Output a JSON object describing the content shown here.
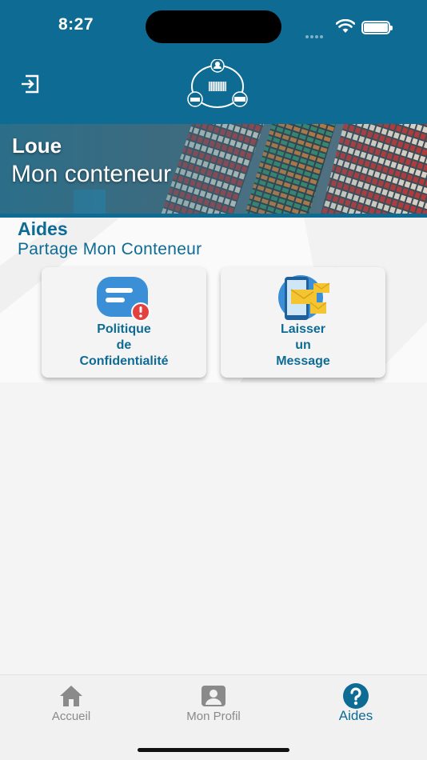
{
  "status_bar": {
    "time": "8:27"
  },
  "header": {
    "logout_icon": "logout-icon",
    "logo_icon": "network-logo-icon"
  },
  "banner": {
    "line1": "Loue",
    "line2": "Mon conteneur"
  },
  "main": {
    "title": "Aides",
    "subtitle": "Partage Mon Conteneur",
    "cards": [
      {
        "label_lines": [
          "Politique",
          "de",
          "Confidentialité"
        ],
        "icon": "privacy-alert-icon"
      },
      {
        "label_lines": [
          "Laisser",
          "un",
          "Message"
        ],
        "icon": "message-phone-icon"
      }
    ]
  },
  "tabbar": {
    "items": [
      {
        "label": "Accueil",
        "icon": "home-icon",
        "active": false
      },
      {
        "label": "Mon Profil",
        "icon": "profile-icon",
        "active": false
      },
      {
        "label": "Aides",
        "icon": "help-icon",
        "active": true
      }
    ]
  },
  "colors": {
    "primary": "#0e6b94",
    "inactive": "#8a8a8a",
    "background": "#f4f4f4"
  }
}
